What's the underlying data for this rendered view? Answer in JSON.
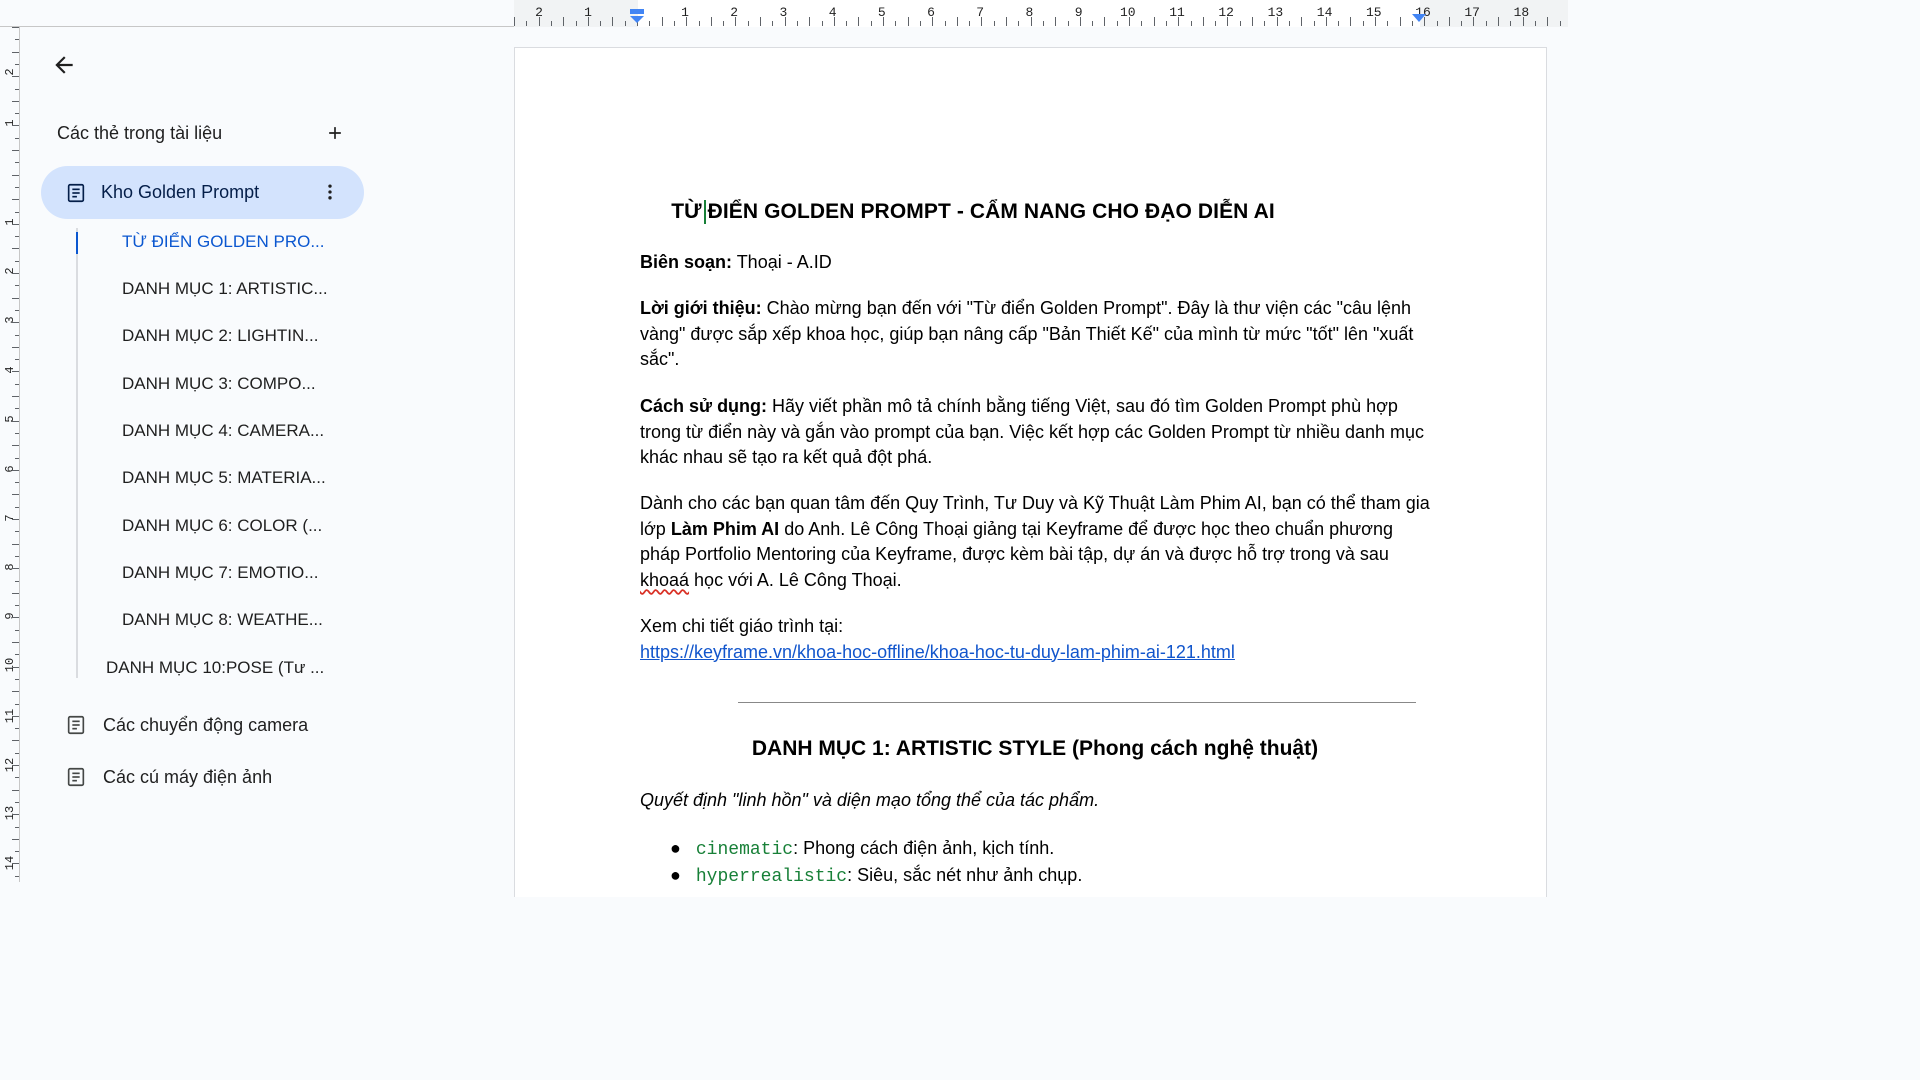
{
  "ruler": {
    "top_numbers": [
      "2",
      "1",
      "1",
      "2",
      "3",
      "4",
      "5",
      "6",
      "7",
      "8",
      "9",
      "10",
      "11",
      "12",
      "13",
      "14",
      "15",
      "16",
      "17",
      "18"
    ],
    "left_numbers": [
      "2",
      "1",
      "1",
      "2",
      "3",
      "4",
      "5",
      "6",
      "7",
      "8",
      "9",
      "10",
      "11",
      "12",
      "13",
      "14"
    ]
  },
  "sidebar": {
    "back_label": "Back",
    "tabs_title": "Các thẻ trong tài liệu",
    "active_tab": "Kho Golden Prompt",
    "outline": [
      "TỪ ĐIỂN GOLDEN PRO...",
      "DANH MỤC 1: ARTISTIC...",
      "DANH MỤC 2: LIGHTIN...",
      "DANH MỤC 3: COMPO...",
      "DANH MỤC 4: CAMERA...",
      "DANH MỤC 5: MATERIA...",
      "DANH MỤC 6: COLOR (...",
      "DANH MỤC 7: EMOTIO...",
      "DANH MỤC 8: WEATHE...",
      "DANH MỤC 10:POSE (Tư ..."
    ],
    "other_tabs": [
      "Các chuyển động camera",
      "Các cú máy điện ảnh"
    ]
  },
  "doc": {
    "title": "TỪ ĐIỂN GOLDEN PROMPT - CẨM NANG CHO ĐẠO DIỄN AI",
    "author_label": "Biên soạn:",
    "author_value": " Thoại - A.ID",
    "intro_label": "Lời giới thiệu:",
    "intro_text": " Chào mừng bạn đến với \"Từ điển Golden Prompt\". Đây là thư viện các \"câu lệnh vàng\" được sắp xếp khoa học, giúp bạn nâng cấp \"Bản Thiết Kế\" của mình từ mức \"tốt\" lên \"xuất sắc\".",
    "usage_label": "Cách sử dụng:",
    "usage_text": " Hãy viết phần mô tả chính bằng tiếng Việt, sau đó tìm Golden Prompt phù hợp trong từ điển này và gắn vào prompt của bạn. Việc kết hợp các Golden Prompt từ nhiều danh mục khác nhau sẽ tạo ra kết quả đột phá.",
    "course_text_1": "Dành cho các bạn quan tâm đến Quy Trình, Tư Duy và Kỹ Thuật Làm Phim AI, bạn có thể tham gia lớp ",
    "course_bold": "Làm Phim AI",
    "course_text_2": " do Anh. Lê Công Thoại giảng tại Keyframe để được học theo chuẩn phương pháp Portfolio Mentoring của Keyframe, được kèm bài tập, dự án và được hỗ trợ trong và sau ",
    "course_squiggle": "khoaá",
    "course_text_3": " học với A. Lê Công Thoại.",
    "detail_label": "Xem chi tiết giáo trình tại:",
    "detail_link": "https://keyframe.vn/khoa-hoc-offline/khoa-hoc-tu-duy-lam-phim-ai-121.html",
    "section1_title": "DANH MỤC 1: ARTISTIC STYLE (Phong cách nghệ thuật)",
    "section1_desc": "Quyết định \"linh hồn\" và diện mạo tổng thể của tác phẩm.",
    "bullets": [
      {
        "code": "cinematic",
        "text": ": Phong cách điện ảnh, kịch tính."
      },
      {
        "code": "hyperrealistic",
        "text": ": Siêu, sắc nét như ảnh chụp."
      }
    ]
  }
}
